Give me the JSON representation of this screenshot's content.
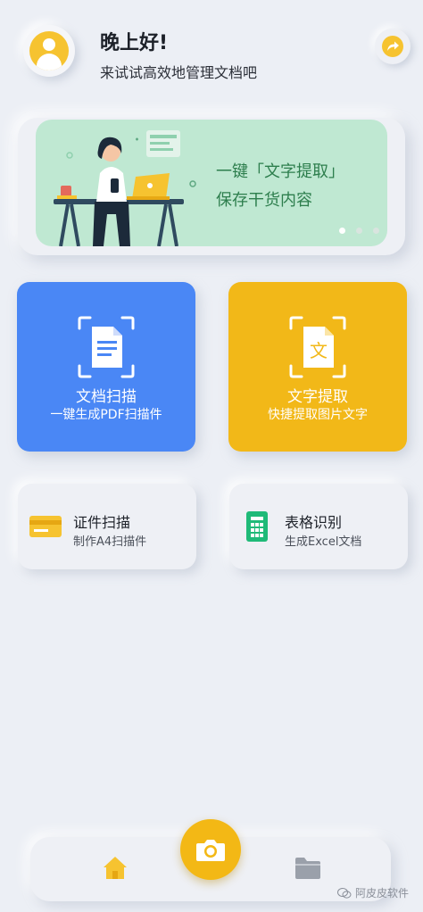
{
  "header": {
    "greeting": "晚上好!",
    "subtitle": "来试试高效地管理文档吧",
    "avatar_icon": "user-avatar-icon",
    "share_icon": "share-arrow-icon"
  },
  "banner": {
    "title": "一键「文字提取」",
    "subtitle": "保存干货内容",
    "background_color": "#bfe8d2",
    "text_color": "#2d7e4d",
    "illustration": "woman-working-at-desk-illustration",
    "carousel_active_index": 0,
    "carousel_count": 3
  },
  "features": [
    {
      "title": "文档扫描",
      "subtitle": "一键生成PDF扫描件",
      "color": "#4a87f5",
      "icon": "document-scan-icon"
    },
    {
      "title": "文字提取",
      "subtitle": "快捷提取图片文字",
      "color": "#f2b818",
      "icon": "text-extract-icon",
      "icon_glyph": "文"
    }
  ],
  "tools": [
    {
      "title": "证件扫描",
      "subtitle": "制作A4扫描件",
      "icon": "id-card-icon"
    },
    {
      "title": "表格识别",
      "subtitle": "生成Excel文档",
      "icon": "spreadsheet-icon"
    }
  ],
  "bottom_nav": {
    "home_icon": "home-icon",
    "camera_icon": "camera-icon",
    "files_icon": "folder-icon",
    "accent_color": "#f3b815"
  },
  "watermark": {
    "text": "阿皮皮软件",
    "icon": "wechat-icon"
  }
}
